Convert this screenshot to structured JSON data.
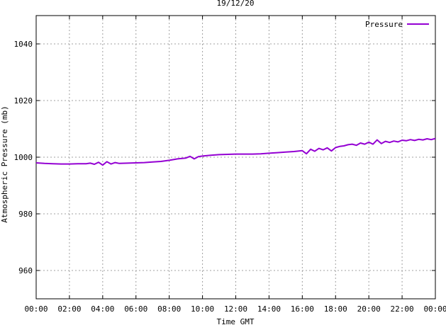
{
  "chart_data": {
    "type": "line",
    "title": "19/12/20",
    "xlabel": "Time GMT",
    "ylabel": "Atmospheric Pressure (mb)",
    "x_ticks": [
      "00:00",
      "02:00",
      "04:00",
      "06:00",
      "08:00",
      "10:00",
      "12:00",
      "14:00",
      "16:00",
      "18:00",
      "20:00",
      "22:00",
      "00:00"
    ],
    "y_ticks": [
      "960",
      "980",
      "1000",
      "1020",
      "1040"
    ],
    "x_range_hours": [
      0,
      24
    ],
    "ylim": [
      950,
      1050
    ],
    "grid": true,
    "legend_position": "top-right",
    "series": [
      {
        "name": "Pressure",
        "color": "#9400d3",
        "x_hours": [
          0,
          0.5,
          1,
          1.5,
          2,
          2.5,
          3,
          3.25,
          3.5,
          3.75,
          4,
          4.25,
          4.5,
          4.75,
          5,
          5.5,
          6,
          6.5,
          7,
          7.5,
          8,
          8.5,
          9,
          9.25,
          9.5,
          9.75,
          10,
          10.5,
          11,
          11.5,
          12,
          12.5,
          13,
          13.5,
          14,
          14.5,
          15,
          15.5,
          16,
          16.25,
          16.5,
          16.75,
          17,
          17.25,
          17.5,
          17.75,
          18,
          18.25,
          18.5,
          18.75,
          19,
          19.25,
          19.5,
          19.75,
          20,
          20.25,
          20.5,
          20.75,
          21,
          21.25,
          21.5,
          21.75,
          22,
          22.25,
          22.5,
          22.75,
          23,
          23.25,
          23.5,
          23.75,
          24
        ],
        "values": [
          998.0,
          997.8,
          997.7,
          997.6,
          997.6,
          997.7,
          997.7,
          997.9,
          997.5,
          998.2,
          997.2,
          998.4,
          997.6,
          998.1,
          997.8,
          997.9,
          998.0,
          998.1,
          998.3,
          998.5,
          998.9,
          999.4,
          999.7,
          1000.3,
          999.4,
          1000.2,
          1000.4,
          1000.7,
          1000.9,
          1001.0,
          1001.1,
          1001.1,
          1001.1,
          1001.2,
          1001.4,
          1001.6,
          1001.8,
          1002.0,
          1002.3,
          1001.2,
          1002.8,
          1002.1,
          1003.1,
          1002.6,
          1003.3,
          1002.2,
          1003.4,
          1003.8,
          1004.0,
          1004.4,
          1004.6,
          1004.2,
          1005.0,
          1004.6,
          1005.3,
          1004.6,
          1006.1,
          1004.8,
          1005.6,
          1005.2,
          1005.7,
          1005.4,
          1006.0,
          1005.8,
          1006.2,
          1005.9,
          1006.3,
          1006.1,
          1006.5,
          1006.2,
          1006.6
        ]
      }
    ]
  }
}
